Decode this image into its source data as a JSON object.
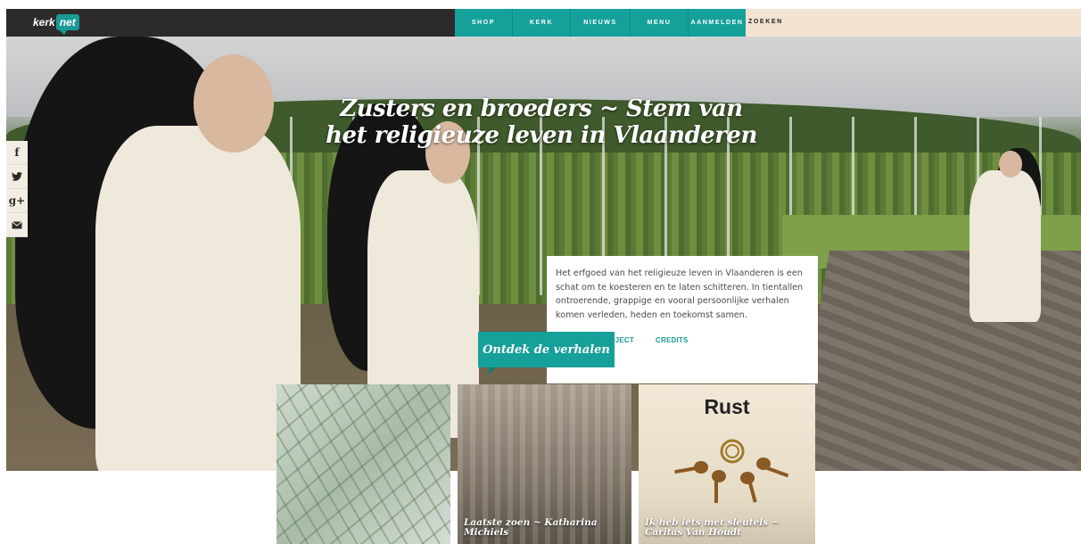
{
  "brand": {
    "logo_a": "kerk",
    "logo_b": "net"
  },
  "nav": {
    "items": [
      "SHOP",
      "KERK",
      "NIEUWS",
      "MENU",
      "AANMELDEN"
    ],
    "search": "ZOEKEN"
  },
  "hero": {
    "title": "Zusters en broeders ~ Stem van het religieuze leven in Vlaanderen"
  },
  "social": {
    "items": [
      "f",
      "twitter",
      "g+",
      "mail"
    ]
  },
  "intro": {
    "text": "Het erfgoed van het religieuze leven in Vlaanderen is een schat om te koesteren en te laten schitteren. In tientallen ontroerende, grappige en vooral persoonlijke verhalen komen verleden, heden en toekomst samen.",
    "link_project": "OVER DIT PROJECT",
    "link_credits": "CREDITS"
  },
  "cta": {
    "label": "Ontdek de verhalen"
  },
  "cards": [
    {
      "caption": ""
    },
    {
      "caption": "Laatste zoen ~ Katharina Michiels"
    },
    {
      "title": "Rust",
      "caption": "Ik heb iets met sleutels ~ Caritas Van Houdt"
    }
  ],
  "colors": {
    "accent": "#16a09a",
    "topbar": "#2d2b2a",
    "search_bg": "#f3e3d2"
  }
}
